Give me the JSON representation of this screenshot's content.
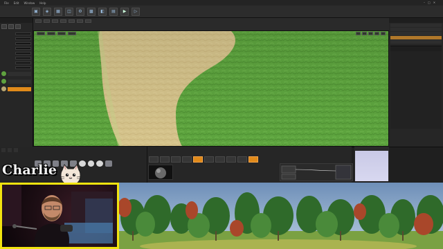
{
  "menu": {
    "items": [
      "File",
      "Edit",
      "Window",
      "Help"
    ]
  },
  "toolbar": {
    "buttons": [
      {
        "name": "save-icon",
        "glyph": "▣"
      },
      {
        "name": "source-control-icon",
        "glyph": "◈"
      },
      {
        "name": "content-icon",
        "glyph": "▦"
      },
      {
        "name": "marketplace-icon",
        "glyph": "◫"
      },
      {
        "name": "settings-icon",
        "glyph": "⚙"
      },
      {
        "name": "blueprints-icon",
        "glyph": "▩"
      },
      {
        "name": "cinematics-icon",
        "glyph": "◧"
      },
      {
        "name": "build-icon",
        "glyph": "▤"
      },
      {
        "name": "play-icon",
        "glyph": "▶"
      },
      {
        "name": "launch-icon",
        "glyph": "▷"
      }
    ]
  },
  "overlay": {
    "streamer_name": "Charlie"
  },
  "colors": {
    "accent": "#e08a1a",
    "webcam_border": "#f2e40f",
    "grass": "#5fa23f",
    "sand": "#d9c88f"
  }
}
